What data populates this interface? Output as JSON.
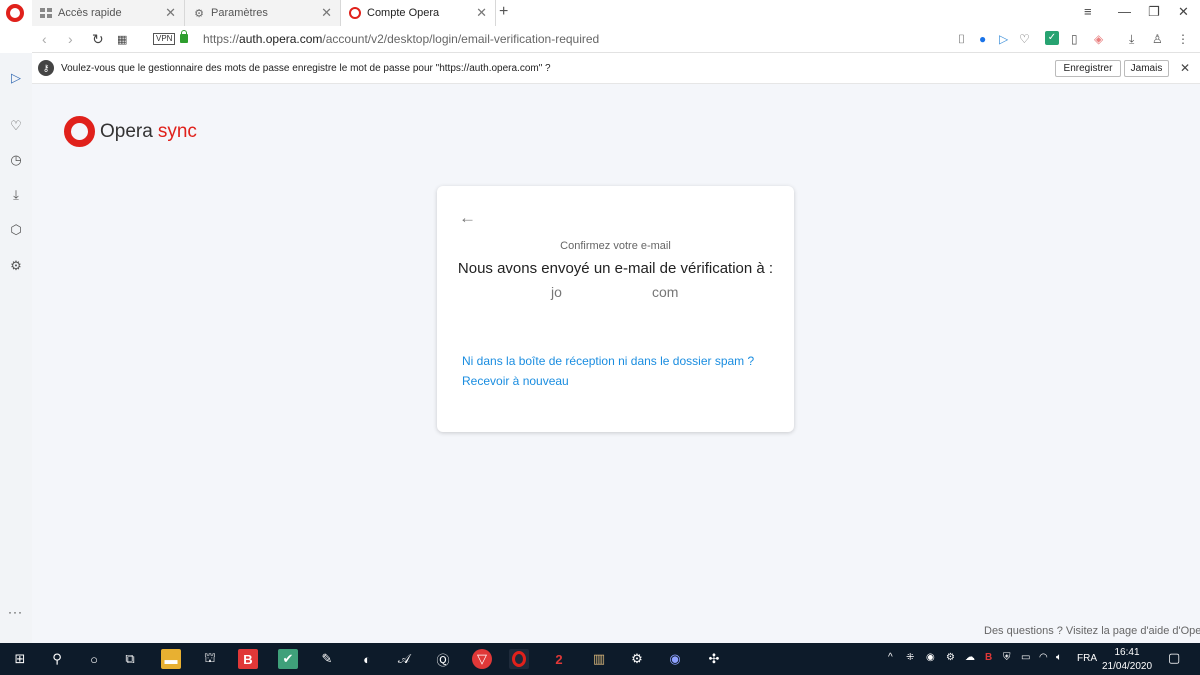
{
  "tabs": [
    {
      "label": "Accès rapide",
      "icon": "grid-icon"
    },
    {
      "label": "Paramètres",
      "icon": "gear-icon"
    },
    {
      "label": "Compte Opera",
      "icon": "opera-icon"
    }
  ],
  "address": {
    "vpn_label": "VPN",
    "url_prefix": "https://",
    "url_host": "auth.opera.com",
    "url_path": "/account/v2/desktop/login/email-verification-required"
  },
  "password_bar": {
    "message": "Voulez-vous que le gestionnaire des mots de passe enregistre le mot de passe pour \"https://auth.opera.com\" ?",
    "save_label": "Enregistrer",
    "never_label": "Jamais"
  },
  "brand": {
    "name": "Opera",
    "product": "sync"
  },
  "card": {
    "subtitle": "Confirmez votre e-mail",
    "title": "Nous avons envoyé un e-mail de vérification à :",
    "email_start": "jo",
    "email_end": "com",
    "link_not_received": "Ni dans la boîte de réception ni dans le dossier spam ?",
    "link_resend": "Recevoir à nouveau"
  },
  "help_text": "Des questions ? Visitez la page d'aide d'Opera",
  "taskbar": {
    "language": "FRA",
    "time": "16:41",
    "date": "21/04/2020"
  },
  "colors": {
    "accent": "#e0211b",
    "link": "#1a8de0",
    "page_bg": "#f4f6fa",
    "taskbar": "#0d1b2a"
  }
}
